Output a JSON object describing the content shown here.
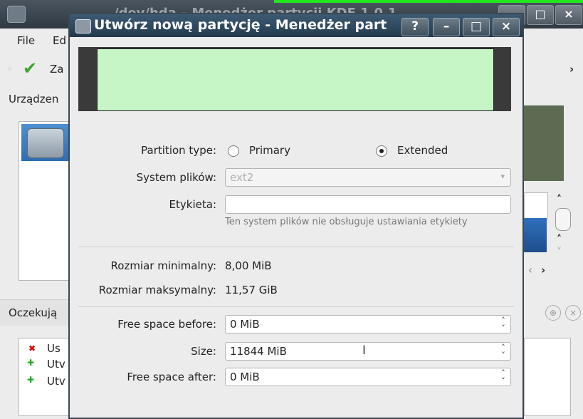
{
  "main_window": {
    "title": "/dev/hda – Menedżer partycji KDE 1.0.1",
    "menu": {
      "file": "File",
      "edit": "Ed"
    },
    "toolbar": {
      "apply_label": "Za"
    },
    "devices_label": "Urządzen",
    "pending_label": "Oczekują",
    "pending_items": [
      "Us",
      "Utv",
      "Utv"
    ],
    "window_buttons": [
      "–",
      "□",
      "×"
    ]
  },
  "dialog": {
    "title": "Utwórz nową partycję - Menedżer part",
    "title_buttons": [
      "?",
      "–",
      "□",
      "×"
    ],
    "partition_type_label": "Partition type:",
    "radio_primary": "Primary",
    "radio_extended": "Extended",
    "selected_type": "Extended",
    "filesystem_label": "System plików:",
    "filesystem_value": "ext2",
    "label_label": "Etykieta:",
    "label_value": "",
    "label_note": "Ten system plików nie obsługuje ustawiania etykiety",
    "min_size_label": "Rozmiar minimalny:",
    "min_size_value": "8,00 MiB",
    "max_size_label": "Rozmiar maksymalny:",
    "max_size_value": "11,57 GiB",
    "free_before_label": "Free space before:",
    "free_before_value": "0 MiB",
    "size_label": "Size:",
    "size_value": "11844 MiB",
    "free_after_label": "Free space after:",
    "free_after_value": "0 MiB"
  },
  "colors": {
    "partition_fill": "#c6f5c6",
    "dialog_title_bg": "#2f4a62",
    "accent_green": "#23e61f"
  }
}
